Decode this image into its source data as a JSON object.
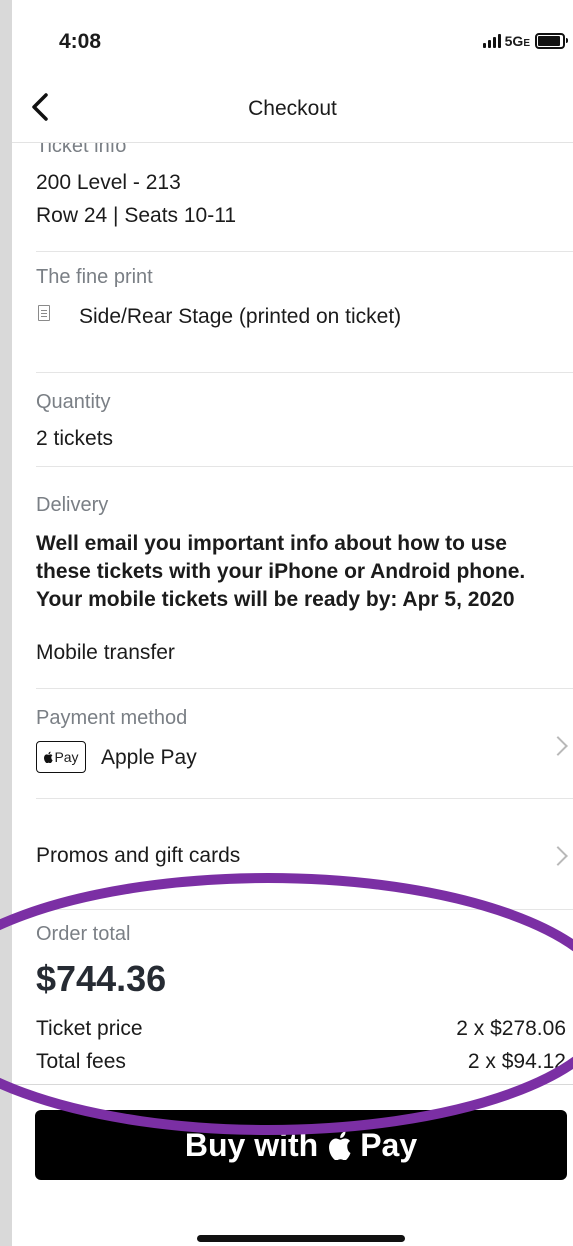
{
  "status": {
    "time": "4:08",
    "network": "5G",
    "network_suffix": "E"
  },
  "nav": {
    "title": "Checkout"
  },
  "ticket_info": {
    "label": "Ticket info",
    "section": "200 Level - 213",
    "seats": "Row 24 | Seats 10-11"
  },
  "fine_print": {
    "label": "The fine print",
    "text": "Side/Rear Stage (printed on ticket)"
  },
  "quantity": {
    "label": "Quantity",
    "value": "2 tickets"
  },
  "delivery": {
    "label": "Delivery",
    "description": "Well email you important info about how to use these tickets with your iPhone or Android phone. Your mobile tickets will be ready by: Apr 5, 2020",
    "method": "Mobile transfer"
  },
  "payment": {
    "label": "Payment method",
    "badge": "Pay",
    "value": "Apple Pay"
  },
  "promos": {
    "label": "Promos and gift cards"
  },
  "order": {
    "label": "Order total",
    "total": "$744.36",
    "ticket_price_label": "Ticket price",
    "ticket_price_value": "2 x $278.06",
    "fees_label": "Total fees",
    "fees_value": "2 x $94.12"
  },
  "buy_button": {
    "label_prefix": "Buy with",
    "label_suffix": "Pay"
  },
  "colors": {
    "annotation_circle": "#7b2fa4",
    "button": "#000000"
  }
}
